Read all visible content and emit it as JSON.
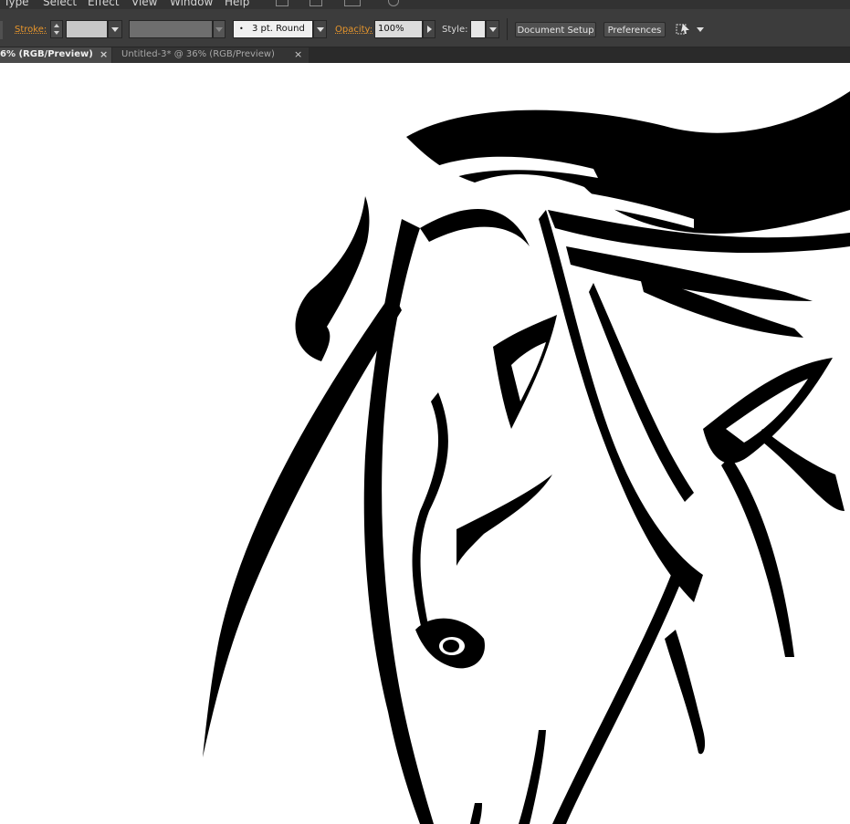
{
  "menu": {
    "items": [
      "Type",
      "Select",
      "Effect",
      "View",
      "Window",
      "Help"
    ]
  },
  "control_bar": {
    "stroke_label": "Stroke:",
    "brush_value": "3 pt. Round",
    "opacity_label": "Opacity:",
    "opacity_value": "100%",
    "style_label": "Style:",
    "document_setup": "Document Setup",
    "preferences": "Preferences"
  },
  "tabs": [
    {
      "title": "6% (RGB/Preview)",
      "active": true
    },
    {
      "title": "Untitled-3* @ 36% (RGB/Preview)",
      "active": false
    }
  ],
  "canvas": {
    "artwork": "horse-head-icon",
    "background": "#ffffff"
  },
  "colors": {
    "accent": "#e8962c",
    "panel": "#3c3c3c",
    "menubar": "#323232"
  }
}
